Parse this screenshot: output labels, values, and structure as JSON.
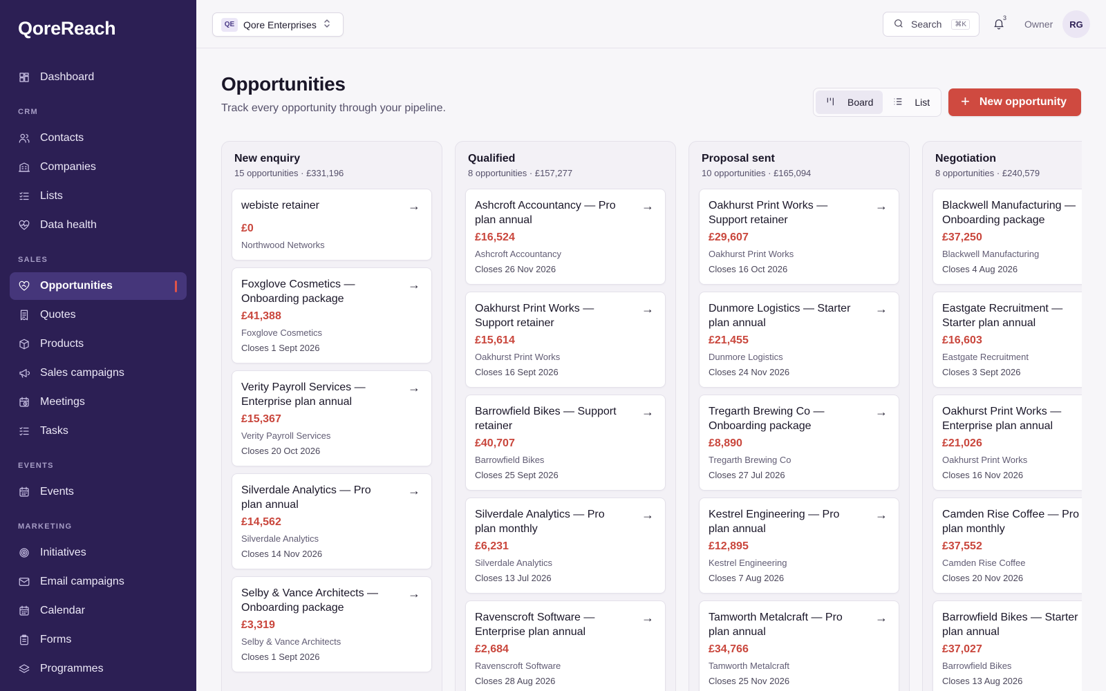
{
  "app": {
    "name": "QoreReach"
  },
  "sidebar": {
    "top_items": [
      {
        "label": "Dashboard",
        "icon": "dashboard-icon"
      }
    ],
    "sections": [
      {
        "title": "CRM",
        "items": [
          {
            "label": "Contacts",
            "icon": "users-icon"
          },
          {
            "label": "Companies",
            "icon": "building-icon"
          },
          {
            "label": "Lists",
            "icon": "list-check-icon"
          },
          {
            "label": "Data health",
            "icon": "heart-pulse-icon"
          }
        ]
      },
      {
        "title": "SALES",
        "items": [
          {
            "label": "Opportunities",
            "icon": "handshake-icon",
            "active": true
          },
          {
            "label": "Quotes",
            "icon": "receipt-icon"
          },
          {
            "label": "Products",
            "icon": "box-icon"
          },
          {
            "label": "Sales campaigns",
            "icon": "megaphone-icon"
          },
          {
            "label": "Meetings",
            "icon": "calendar-clock-icon"
          },
          {
            "label": "Tasks",
            "icon": "checklist-icon"
          }
        ]
      },
      {
        "title": "EVENTS",
        "items": [
          {
            "label": "Events",
            "icon": "calendar-icon"
          }
        ]
      },
      {
        "title": "MARKETING",
        "items": [
          {
            "label": "Initiatives",
            "icon": "target-icon"
          },
          {
            "label": "Email campaigns",
            "icon": "mail-icon"
          },
          {
            "label": "Calendar",
            "icon": "calendar-icon"
          },
          {
            "label": "Forms",
            "icon": "clipboard-icon"
          },
          {
            "label": "Programmes",
            "icon": "layers-icon"
          }
        ]
      }
    ]
  },
  "topbar": {
    "org_badge": "QE",
    "org_name": "Qore Enterprises",
    "search_label": "Search",
    "search_shortcut": "⌘K",
    "notification_count": "3",
    "role": "Owner",
    "avatar_initials": "RG"
  },
  "page": {
    "title": "Opportunities",
    "subtitle": "Track every opportunity through your pipeline.",
    "view_board": "Board",
    "view_list": "List",
    "new_button": "New opportunity"
  },
  "colors": {
    "sidebar": "#2c1f54",
    "accent": "#cf4a40",
    "amount": "#c9463c"
  },
  "board": {
    "columns": [
      {
        "title": "New enquiry",
        "meta": "15 opportunities · £331,196",
        "cards": [
          {
            "title": "webiste retainer",
            "amount": "£0",
            "company": "Northwood Networks",
            "close": ""
          },
          {
            "title": "Foxglove Cosmetics — Onboarding package",
            "amount": "£41,388",
            "company": "Foxglove Cosmetics",
            "close": "Closes 1 Sept 2026"
          },
          {
            "title": "Verity Payroll Services — Enterprise plan annual",
            "amount": "£15,367",
            "company": "Verity Payroll Services",
            "close": "Closes 20 Oct 2026"
          },
          {
            "title": "Silverdale Analytics — Pro plan annual",
            "amount": "£14,562",
            "company": "Silverdale Analytics",
            "close": "Closes 14 Nov 2026"
          },
          {
            "title": "Selby & Vance Architects — Onboarding package",
            "amount": "£3,319",
            "company": "Selby & Vance Architects",
            "close": "Closes 1 Sept 2026"
          }
        ]
      },
      {
        "title": "Qualified",
        "meta": "8 opportunities · £157,277",
        "cards": [
          {
            "title": "Ashcroft Accountancy — Pro plan annual",
            "amount": "£16,524",
            "company": "Ashcroft Accountancy",
            "close": "Closes 26 Nov 2026"
          },
          {
            "title": "Oakhurst Print Works — Support retainer",
            "amount": "£15,614",
            "company": "Oakhurst Print Works",
            "close": "Closes 16 Sept 2026"
          },
          {
            "title": "Barrowfield Bikes — Support retainer",
            "amount": "£40,707",
            "company": "Barrowfield Bikes",
            "close": "Closes 25 Sept 2026"
          },
          {
            "title": "Silverdale Analytics — Pro plan monthly",
            "amount": "£6,231",
            "company": "Silverdale Analytics",
            "close": "Closes 13 Jul 2026"
          },
          {
            "title": "Ravenscroft Software — Enterprise plan annual",
            "amount": "£2,684",
            "company": "Ravenscroft Software",
            "close": "Closes 28 Aug 2026"
          }
        ]
      },
      {
        "title": "Proposal sent",
        "meta": "10 opportunities · £165,094",
        "cards": [
          {
            "title": "Oakhurst Print Works — Support retainer",
            "amount": "£29,607",
            "company": "Oakhurst Print Works",
            "close": "Closes 16 Oct 2026"
          },
          {
            "title": "Dunmore Logistics — Starter plan annual",
            "amount": "£21,455",
            "company": "Dunmore Logistics",
            "close": "Closes 24 Nov 2026"
          },
          {
            "title": "Tregarth Brewing Co — Onboarding package",
            "amount": "£8,890",
            "company": "Tregarth Brewing Co",
            "close": "Closes 27 Jul 2026"
          },
          {
            "title": "Kestrel Engineering — Pro plan annual",
            "amount": "£12,895",
            "company": "Kestrel Engineering",
            "close": "Closes 7 Aug 2026"
          },
          {
            "title": "Tamworth Metalcraft — Pro plan annual",
            "amount": "£34,766",
            "company": "Tamworth Metalcraft",
            "close": "Closes 25 Nov 2026"
          }
        ]
      },
      {
        "title": "Negotiation",
        "meta": "8 opportunities · £240,579",
        "cards": [
          {
            "title": "Blackwell Manufacturing — Onboarding package",
            "amount": "£37,250",
            "company": "Blackwell Manufacturing",
            "close": "Closes 4 Aug 2026"
          },
          {
            "title": "Eastgate Recruitment — Starter plan annual",
            "amount": "£16,603",
            "company": "Eastgate Recruitment",
            "close": "Closes 3 Sept 2026"
          },
          {
            "title": "Oakhurst Print Works — Enterprise plan annual",
            "amount": "£21,026",
            "company": "Oakhurst Print Works",
            "close": "Closes 16 Nov 2026"
          },
          {
            "title": "Camden Rise Coffee — Pro plan monthly",
            "amount": "£37,552",
            "company": "Camden Rise Coffee",
            "close": "Closes 20 Nov 2026"
          },
          {
            "title": "Barrowfield Bikes — Starter plan annual",
            "amount": "£37,027",
            "company": "Barrowfield Bikes",
            "close": "Closes 13 Aug 2026"
          }
        ]
      }
    ]
  }
}
